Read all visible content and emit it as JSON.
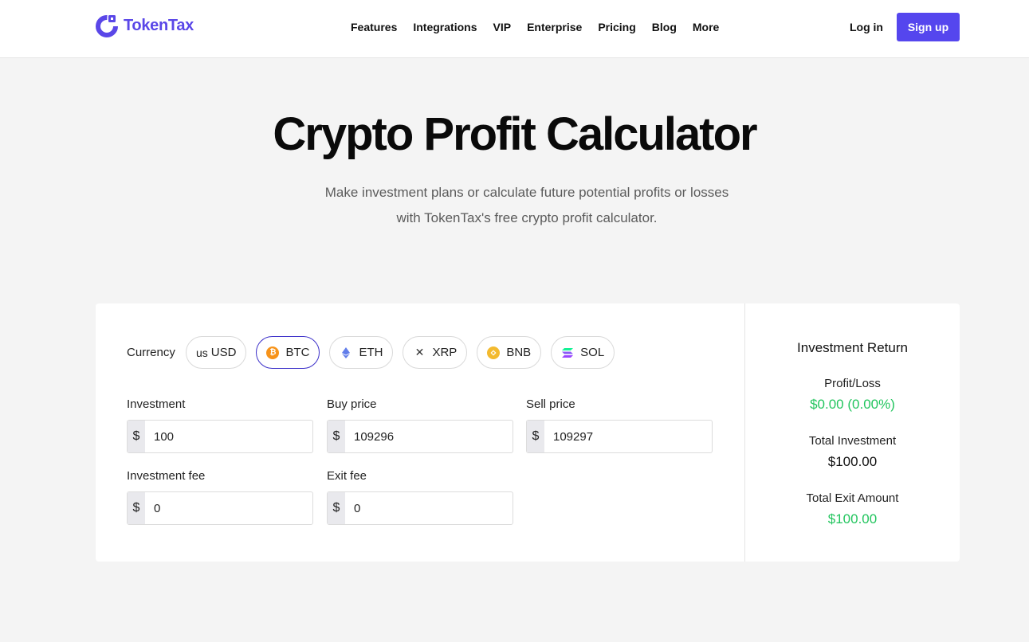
{
  "brand": {
    "name": "TokenTax",
    "accent": "#5546ee"
  },
  "nav": {
    "items": [
      "Features",
      "Integrations",
      "VIP",
      "Enterprise",
      "Pricing",
      "Blog",
      "More"
    ]
  },
  "auth": {
    "login": "Log in",
    "signup": "Sign up"
  },
  "hero": {
    "title": "Crypto Profit Calculator",
    "subtitle": "Make investment plans or calculate future potential profits or losses with TokenTax's free crypto profit calculator."
  },
  "calculator": {
    "currency_label": "Currency",
    "currencies": [
      {
        "prefix": "us",
        "label": "USD",
        "icon": "",
        "selected": false
      },
      {
        "label": "BTC",
        "icon": "bitcoin-icon",
        "color": "#f7931a",
        "selected": true
      },
      {
        "label": "ETH",
        "icon": "ethereum-icon",
        "color": "#627eea",
        "selected": false
      },
      {
        "label": "XRP",
        "icon": "xrp-icon",
        "color": "#333333",
        "selected": false
      },
      {
        "label": "BNB",
        "icon": "bnb-icon",
        "color": "#f3ba2f",
        "selected": false
      },
      {
        "label": "SOL",
        "icon": "solana-icon",
        "color": "#9945ff",
        "selected": false
      }
    ],
    "fields": {
      "investment": {
        "label": "Investment",
        "prefix": "$",
        "value": "100"
      },
      "buy_price": {
        "label": "Buy price",
        "prefix": "$",
        "value": "109296"
      },
      "sell_price": {
        "label": "Sell price",
        "prefix": "$",
        "value": "109297"
      },
      "investment_fee": {
        "label": "Investment fee",
        "prefix": "$",
        "value": "0"
      },
      "exit_fee": {
        "label": "Exit fee",
        "prefix": "$",
        "value": "0"
      }
    }
  },
  "results": {
    "title": "Investment Return",
    "profit_label": "Profit/Loss",
    "profit_value": "$0.00 (0.00%)",
    "total_investment_label": "Total Investment",
    "total_investment_value": "$100.00",
    "exit_label": "Total Exit Amount",
    "exit_value": "$100.00",
    "positive_color": "#22c55e"
  }
}
